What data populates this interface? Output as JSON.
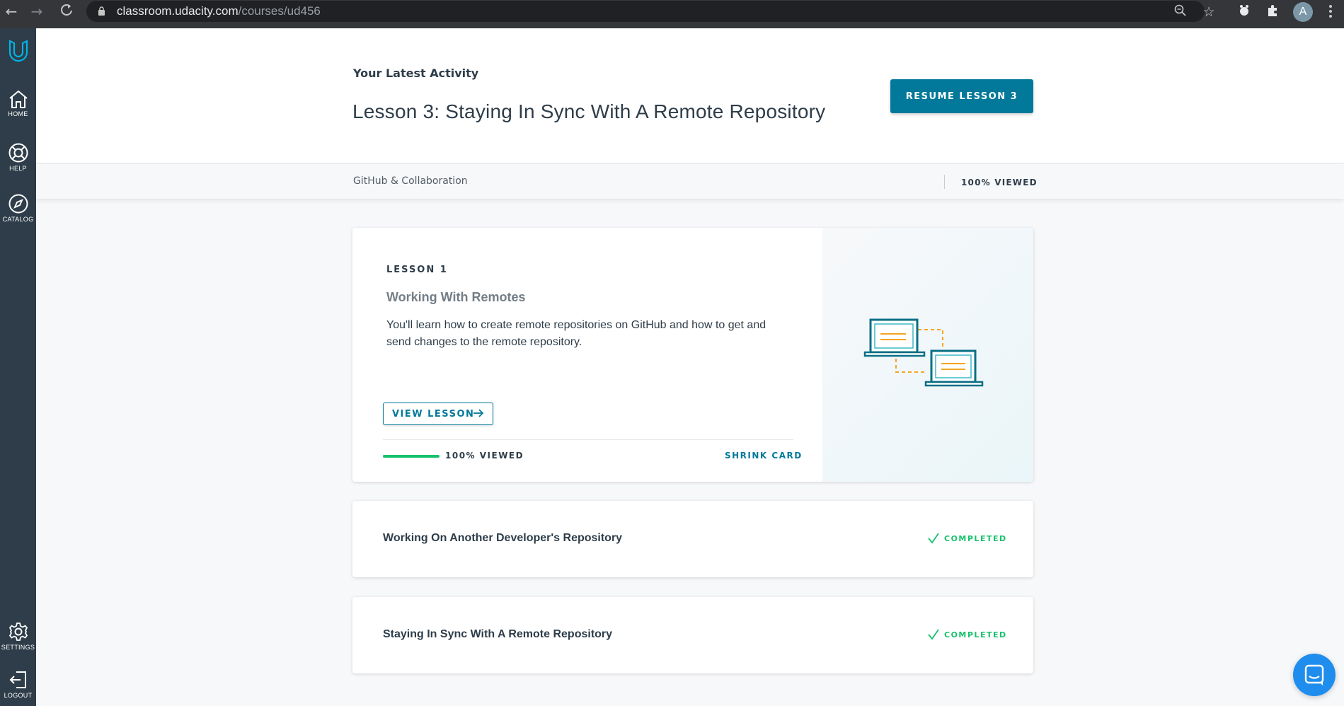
{
  "browser": {
    "url_host": "classroom.udacity.com",
    "url_path": "/courses/ud456",
    "profile_initial": "A"
  },
  "sidebar": {
    "items": [
      {
        "label": "HOME",
        "icon": "home-icon"
      },
      {
        "label": "HELP",
        "icon": "help-icon"
      },
      {
        "label": "CATALOG",
        "icon": "compass-icon"
      },
      {
        "label": "SETTINGS",
        "icon": "gear-icon"
      },
      {
        "label": "LOGOUT",
        "icon": "logout-icon"
      }
    ]
  },
  "header": {
    "latest_label": "Your Latest Activity",
    "lesson_title": "Lesson 3: Staying In Sync With A Remote Repository",
    "resume_button": "RESUME LESSON 3",
    "course_name": "GitHub & Collaboration",
    "viewed": "100% VIEWED"
  },
  "lessons": [
    {
      "number": "LESSON 1",
      "title": "Working With Remotes",
      "description": "You'll learn how to create remote repositories on GitHub and how to get and send changes to the remote repository.",
      "view_button": "VIEW LESSON",
      "progress_fraction": 1.0,
      "viewed": "100% VIEWED",
      "shrink": "SHRINK CARD"
    },
    {
      "title": "Working On Another Developer's Repository",
      "status": "COMPLETED"
    },
    {
      "title": "Staying In Sync With A Remote Repository",
      "status": "COMPLETED"
    }
  ],
  "colors": {
    "sidebar": "#2e3d49",
    "accent": "#02799a",
    "success": "#15c26b",
    "chat": "#1f8ded"
  }
}
